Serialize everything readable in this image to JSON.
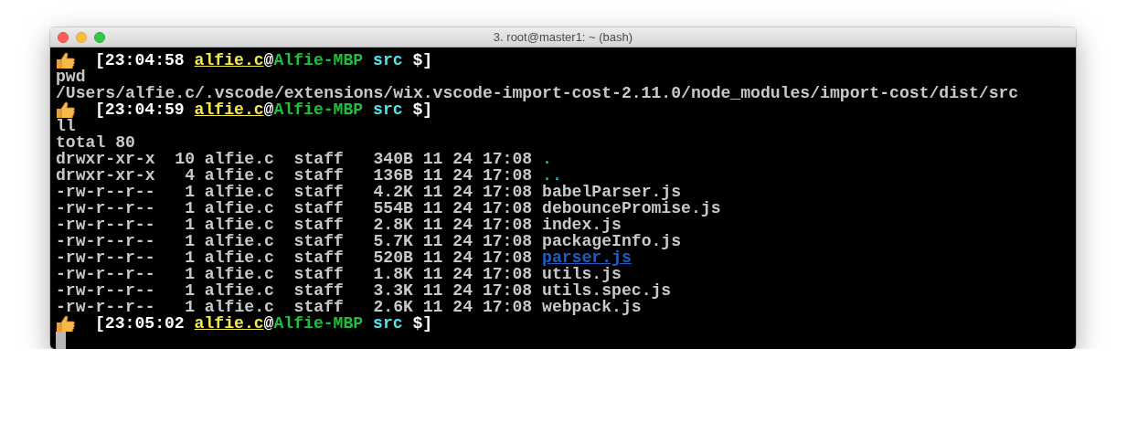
{
  "window": {
    "title": "3. root@master1: ~ (bash)"
  },
  "lines": [
    {
      "kind": "prompt",
      "segments": [
        {
          "kind": "plain",
          "text": "[23:04:58"
        },
        {
          "kind": "user",
          "text": "alfie.c"
        },
        {
          "kind": "plain",
          "text": "@"
        },
        {
          "kind": "host",
          "text": "Alfie-MBP"
        },
        {
          "kind": "dir",
          "text": "src"
        },
        {
          "kind": "plain",
          "text": "$]"
        }
      ]
    },
    {
      "kind": "output",
      "text": "pwd"
    },
    {
      "kind": "output",
      "text": "/Users/alfie.c/.vscode/extensions/wix.vscode-import-cost-2.11.0/node_modules/import-cost/dist/src"
    },
    {
      "kind": "prompt",
      "segments": [
        {
          "kind": "plain",
          "text": "[23:04:59"
        },
        {
          "kind": "user",
          "text": "alfie.c"
        },
        {
          "kind": "plain",
          "text": "@"
        },
        {
          "kind": "host",
          "text": "Alfie-MBP"
        },
        {
          "kind": "dir",
          "text": "src"
        },
        {
          "kind": "plain",
          "text": "$]"
        }
      ]
    },
    {
      "kind": "output",
      "text": "ll"
    },
    {
      "kind": "output",
      "text": "total 80"
    },
    {
      "kind": "entry",
      "info": "drwxr-xr-x  10 alfie.c  staff   340B 11 24 17:08",
      "name": {
        "kind": "dir",
        "text": "."
      }
    },
    {
      "kind": "entry",
      "info": "drwxr-xr-x   4 alfie.c  staff   136B 11 24 17:08",
      "name": {
        "kind": "dir",
        "text": ".."
      }
    },
    {
      "kind": "entry",
      "info": "-rw-r--r--   1 alfie.c  staff   4.2K 11 24 17:08",
      "name": {
        "kind": "file",
        "text": "babelParser.js"
      }
    },
    {
      "kind": "entry",
      "info": "-rw-r--r--   1 alfie.c  staff   554B 11 24 17:08",
      "name": {
        "kind": "file",
        "text": "debouncePromise.js"
      }
    },
    {
      "kind": "entry",
      "info": "-rw-r--r--   1 alfie.c  staff   2.8K 11 24 17:08",
      "name": {
        "kind": "file",
        "text": "index.js"
      }
    },
    {
      "kind": "entry",
      "info": "-rw-r--r--   1 alfie.c  staff   5.7K 11 24 17:08",
      "name": {
        "kind": "file",
        "text": "packageInfo.js"
      }
    },
    {
      "kind": "entry",
      "info": "-rw-r--r--   1 alfie.c  staff   520B 11 24 17:08",
      "name": {
        "kind": "link",
        "text": "parser.js"
      }
    },
    {
      "kind": "entry",
      "info": "-rw-r--r--   1 alfie.c  staff   1.8K 11 24 17:08",
      "name": {
        "kind": "file",
        "text": "utils.js"
      }
    },
    {
      "kind": "entry",
      "info": "-rw-r--r--   1 alfie.c  staff   3.3K 11 24 17:08",
      "name": {
        "kind": "file",
        "text": "utils.spec.js"
      }
    },
    {
      "kind": "entry",
      "info": "-rw-r--r--   1 alfie.c  staff   2.6K 11 24 17:08",
      "name": {
        "kind": "file",
        "text": "webpack.js"
      }
    },
    {
      "kind": "prompt",
      "segments": [
        {
          "kind": "plain",
          "text": "[23:05:02"
        },
        {
          "kind": "user",
          "text": "alfie.c"
        },
        {
          "kind": "plain",
          "text": "@"
        },
        {
          "kind": "host",
          "text": "Alfie-MBP"
        },
        {
          "kind": "dir",
          "text": "src"
        },
        {
          "kind": "plain",
          "text": "$]"
        }
      ]
    },
    {
      "kind": "cursor"
    }
  ]
}
